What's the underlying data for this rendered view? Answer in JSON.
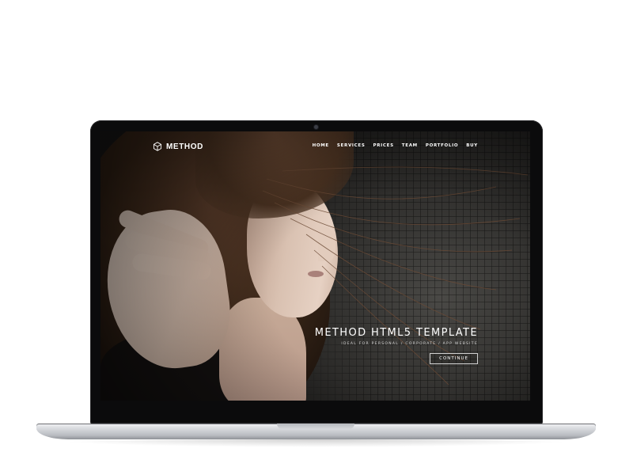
{
  "brand": {
    "name": "METHOD",
    "logo_icon": "hexagon-cube-icon"
  },
  "nav": {
    "items": [
      {
        "label": "HOME"
      },
      {
        "label": "SERVICES"
      },
      {
        "label": "PRICES"
      },
      {
        "label": "TEAM"
      },
      {
        "label": "PORTFOLIO"
      },
      {
        "label": "BUY"
      }
    ]
  },
  "hero": {
    "title": "METHOD HTML5 TEMPLATE",
    "subtitle": "IDEAL FOR PERSONAL / CORPORATE / APP WEBSITE",
    "button_label": "CONTINUE"
  },
  "colors": {
    "background": "#ffffff",
    "bezel": "#0b0b0c",
    "nav_text": "#ffffff",
    "hero_text": "#ffffff",
    "button_border": "#cfcfcf",
    "aluminum": "#d9dbdf"
  }
}
